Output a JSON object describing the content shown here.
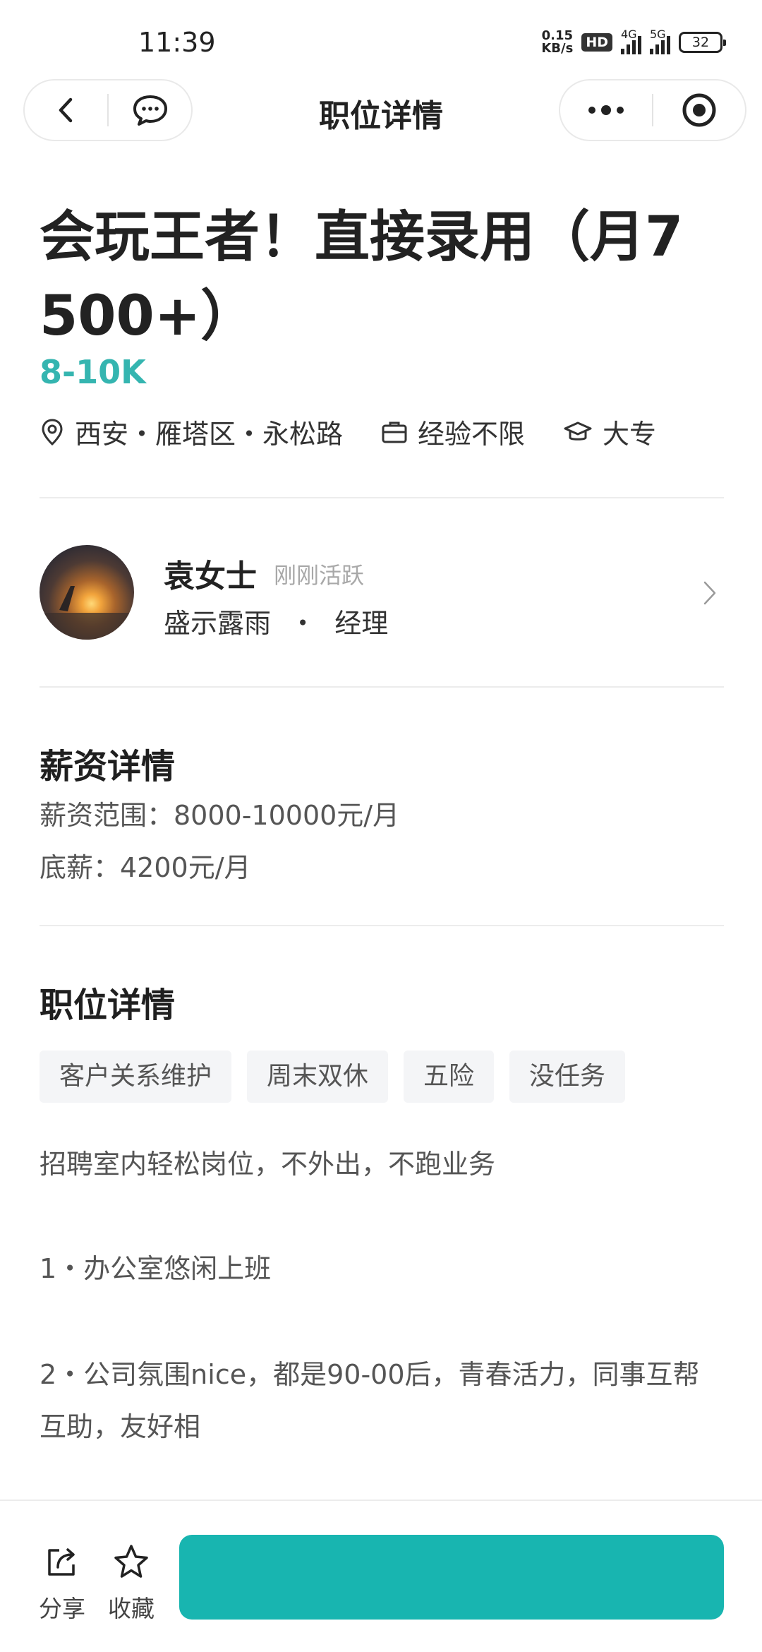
{
  "status_bar": {
    "time": "11:39",
    "net_speed_value": "0.15",
    "net_speed_unit": "KB/s",
    "hd_badge": "HD",
    "signal_1_label": "4G",
    "signal_2_label": "5G",
    "battery": "32"
  },
  "nav": {
    "title": "职位详情"
  },
  "job": {
    "title": "会玩王者！直接录用（月7500+）",
    "salary": "8-10K",
    "location": "西安・雁塔区・永松路",
    "experience": "经验不限",
    "education": "大专"
  },
  "recruiter": {
    "name": "袁女士",
    "active_status": "刚刚活跃",
    "company": "盛示露雨",
    "role_separator": "・",
    "role": "经理"
  },
  "salary_details": {
    "title": "薪资详情",
    "range": "薪资范围：8000-10000元/月",
    "base": "底薪：4200元/月"
  },
  "position_details": {
    "title": "职位详情",
    "tags": [
      "客户关系维护",
      "周末双休",
      "五险",
      "没任务"
    ],
    "intro": "招聘室内轻松岗位，不外出，不跑业务",
    "point_1": "1・办公室悠闲上班",
    "point_2": "2・公司氛围nice，都是90-00后，青春活力，同事互帮互助，友好相"
  },
  "bottom_bar": {
    "share_label": "分享",
    "favorite_label": "收藏",
    "apply_label": ""
  },
  "colors": {
    "accent": "#35b5b0",
    "button": "#18b5b0"
  }
}
